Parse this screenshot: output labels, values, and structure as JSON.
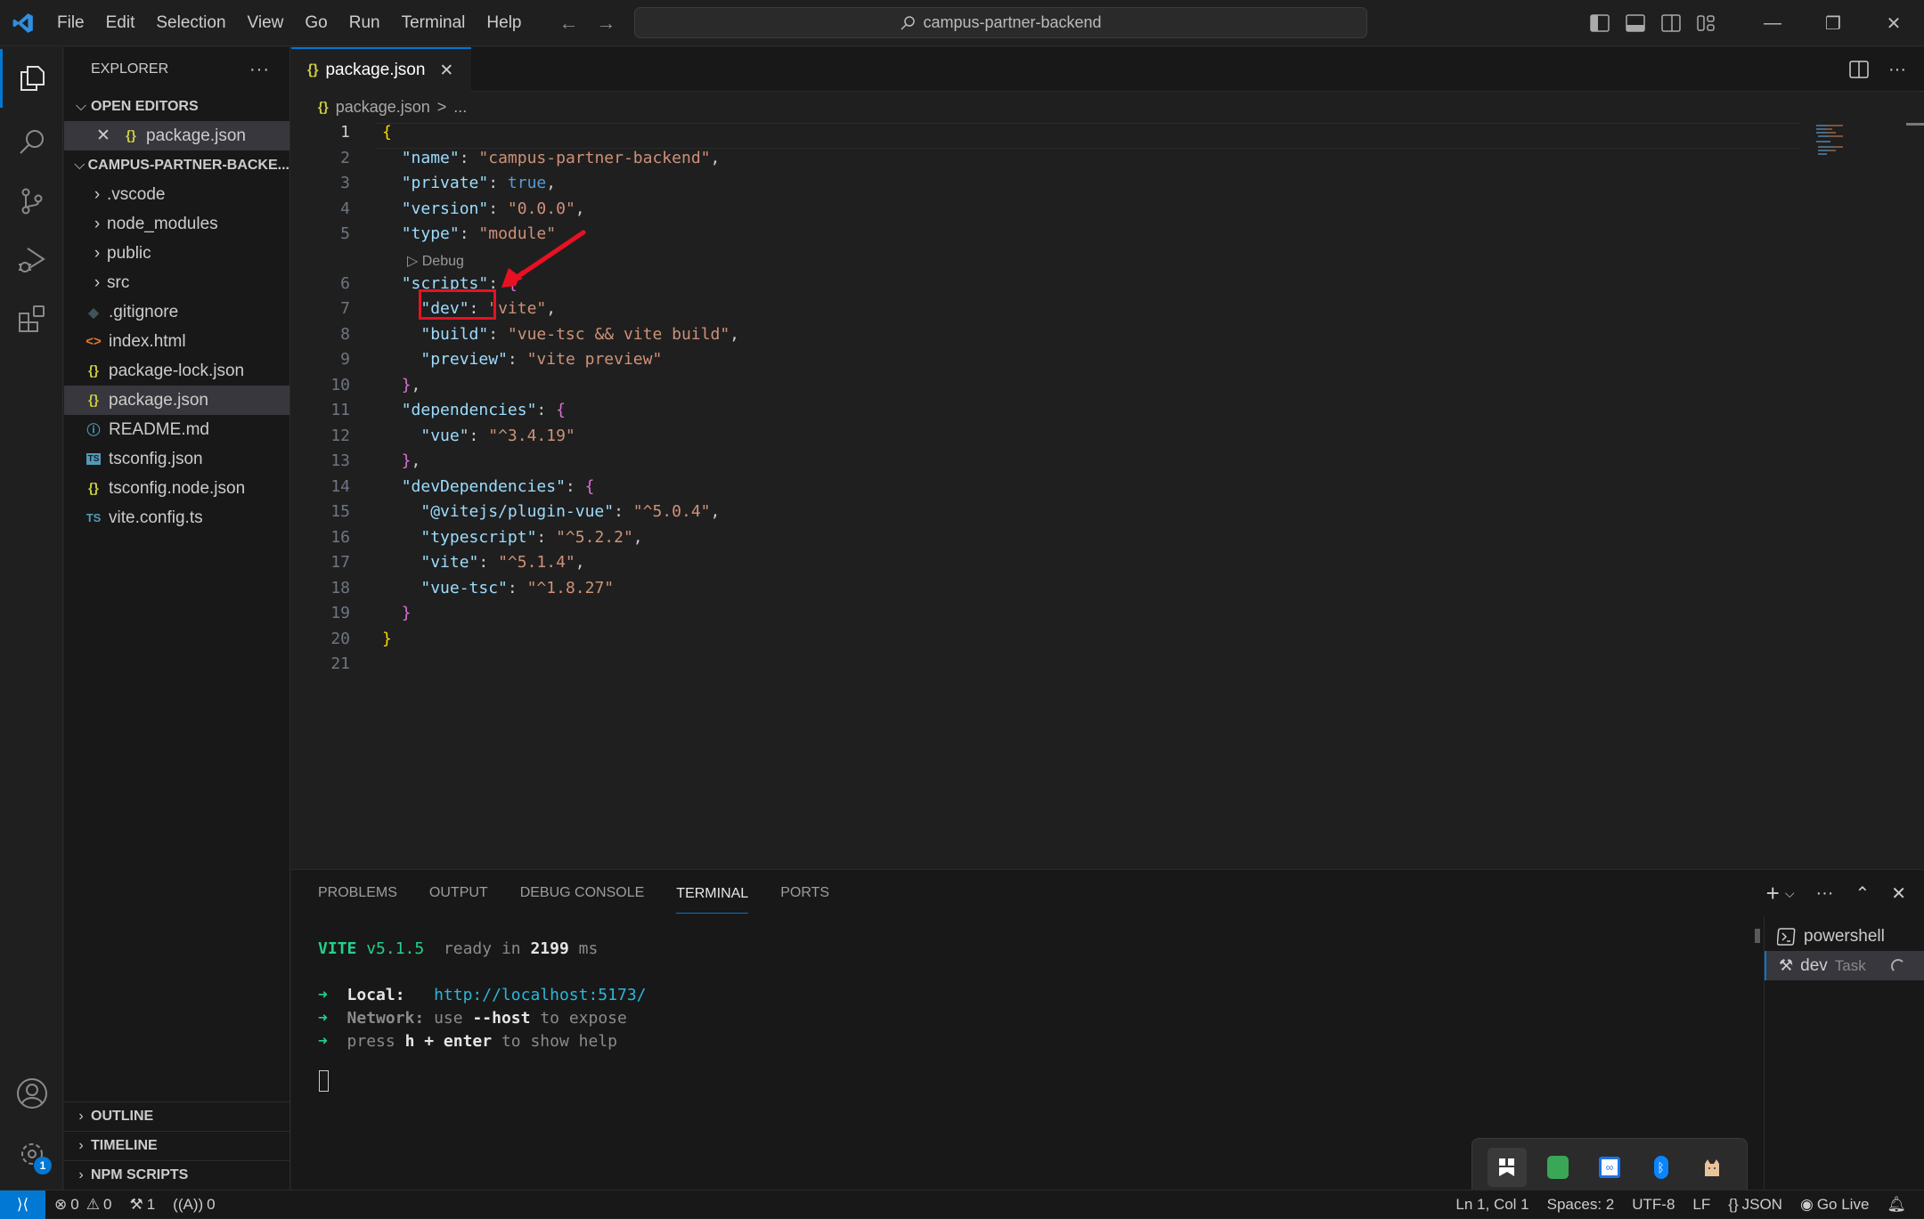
{
  "titlebar": {
    "menu": [
      "File",
      "Edit",
      "Selection",
      "View",
      "Go",
      "Run",
      "Terminal",
      "Help"
    ],
    "search_text": "campus-partner-backend"
  },
  "explorer": {
    "title": "EXPLORER",
    "open_editors_label": "OPEN EDITORS",
    "open_editors": [
      {
        "name": "package.json",
        "icon": "json-braces-icon"
      }
    ],
    "folder_label": "CAMPUS-PARTNER-BACKE...",
    "items": [
      {
        "name": ".vscode",
        "type": "folder"
      },
      {
        "name": "node_modules",
        "type": "folder"
      },
      {
        "name": "public",
        "type": "folder"
      },
      {
        "name": "src",
        "type": "folder"
      },
      {
        "name": ".gitignore",
        "type": "file",
        "icon": "git-icon"
      },
      {
        "name": "index.html",
        "type": "file",
        "icon": "html-icon"
      },
      {
        "name": "package-lock.json",
        "type": "file",
        "icon": "json-braces-icon"
      },
      {
        "name": "package.json",
        "type": "file",
        "icon": "json-braces-icon",
        "selected": true
      },
      {
        "name": "README.md",
        "type": "file",
        "icon": "info-icon"
      },
      {
        "name": "tsconfig.json",
        "type": "file",
        "icon": "ts-config-icon"
      },
      {
        "name": "tsconfig.node.json",
        "type": "file",
        "icon": "json-braces-icon"
      },
      {
        "name": "vite.config.ts",
        "type": "file",
        "icon": "typescript-icon"
      }
    ],
    "bottom_sections": [
      "OUTLINE",
      "TIMELINE",
      "NPM SCRIPTS"
    ]
  },
  "editor": {
    "tab_label": "package.json",
    "breadcrumb": {
      "file": "package.json",
      "sep": ">",
      "rest": "..."
    },
    "codelens": "Debug",
    "lines": [
      "{",
      "  \"name\": \"campus-partner-backend\",",
      "  \"private\": true,",
      "  \"version\": \"0.0.0\",",
      "  \"type\": \"module\"",
      "  \"scripts\": {",
      "    \"dev\": \"vite\",",
      "    \"build\": \"vue-tsc && vite build\",",
      "    \"preview\": \"vite preview\"",
      "  },",
      "  \"dependencies\": {",
      "    \"vue\": \"^3.4.19\"",
      "  },",
      "  \"devDependencies\": {",
      "    \"@vitejs/plugin-vue\": \"^5.0.4\",",
      "    \"typescript\": \"^5.2.2\",",
      "    \"vite\": \"^5.1.4\",",
      "    \"vue-tsc\": \"^1.8.27\"",
      "  }",
      "}",
      ""
    ],
    "current_line": 1
  },
  "panel": {
    "tabs": [
      "PROBLEMS",
      "OUTPUT",
      "DEBUG CONSOLE",
      "TERMINAL",
      "PORTS"
    ],
    "active_tab": "TERMINAL",
    "terminal": {
      "vite_label": "VITE",
      "vite_version": "v5.1.5",
      "ready_text": "ready in",
      "ready_ms": "2199",
      "ms": "ms",
      "arrow": "➜",
      "local_label": "Local:",
      "local_url": "http://localhost:5173/",
      "network_label": "Network:",
      "network_text_1": "use",
      "network_flag": "--host",
      "network_text_2": "to expose",
      "help_1": "press",
      "help_key": "h + enter",
      "help_2": "to show help"
    },
    "terminals": [
      {
        "name": "powershell",
        "icon": "terminal-powershell-icon"
      },
      {
        "name": "dev",
        "suffix": "Task",
        "icon": "tools-icon",
        "selected": true
      }
    ]
  },
  "statusbar": {
    "errors": "0",
    "warnings": "0",
    "tasks": "1",
    "ports": "0",
    "cursor": "Ln 1, Col 1",
    "spaces": "Spaces: 2",
    "encoding": "UTF-8",
    "eol": "LF",
    "language": "JSON",
    "golive": "Go Live"
  },
  "activity": {
    "settings_badge": "1"
  },
  "colors": {
    "accent": "#0078d4",
    "annotation": "#e81123"
  }
}
